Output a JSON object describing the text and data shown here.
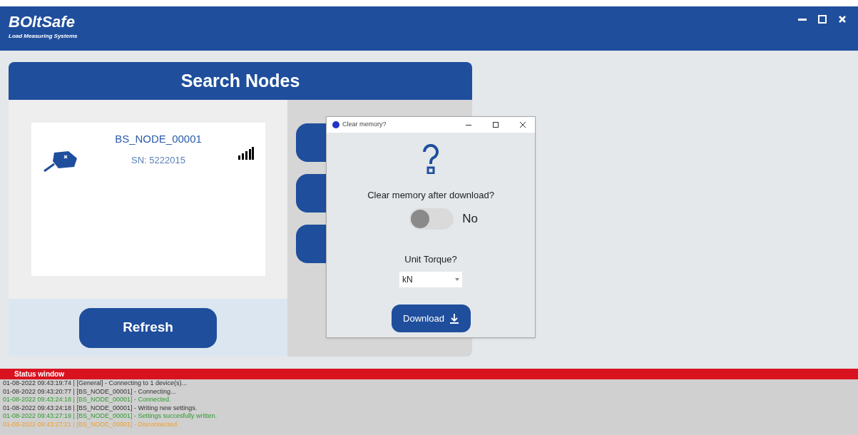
{
  "app": {
    "logo": "BOltSafe",
    "tagline": "Load Measuring Systems"
  },
  "panel": {
    "title": "Search Nodes",
    "nodes": [
      {
        "name": "BS_NODE_00001",
        "serial": "SN: 5222015"
      }
    ],
    "refresh": "Refresh"
  },
  "dialog": {
    "title": "Clear memory?",
    "question": "Clear memory after download?",
    "clear_memory": {
      "on": false,
      "label": "No"
    },
    "unit_label": "Unit Torque?",
    "unit": "kN",
    "download": "Download"
  },
  "status": {
    "title": "Status window",
    "lines": [
      {
        "text": "01-08-2022 09:43:19:74 | [General] - Connecting to 1 device(s)...",
        "kind": "info"
      },
      {
        "text": "01-08-2022 09:43:20:77 | [BS_NODE_00001] - Connecting...",
        "kind": "info"
      },
      {
        "text": "01-08-2022 09:43:24:18 | [BS_NODE_00001] - Connected.",
        "kind": "success"
      },
      {
        "text": "01-08-2022 09:43:24:18 | [BS_NODE_00001] - Writing new settings.",
        "kind": "info"
      },
      {
        "text": "01-08-2022 09:43:27:19 | [BS_NODE_00001] - Settings succesfully written.",
        "kind": "success"
      },
      {
        "text": "01-08-2022 09:43:27:21 | [BS_NODE_00001] - Disconnected.",
        "kind": "warning"
      }
    ]
  }
}
